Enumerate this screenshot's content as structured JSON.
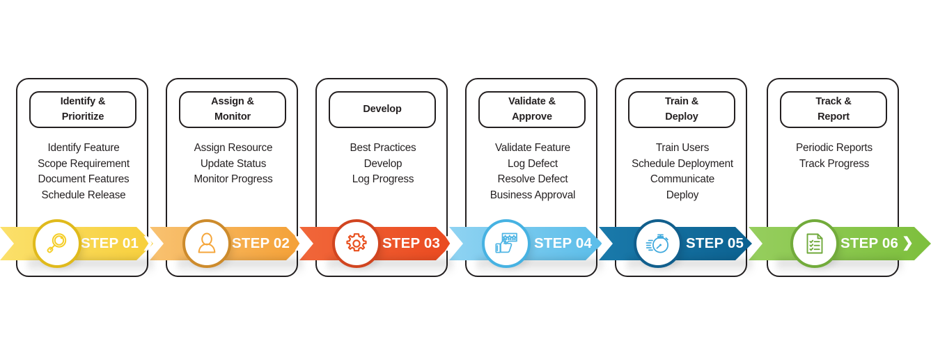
{
  "diagram": {
    "title": "Six Step Process Infographic",
    "type": "horizontal-step-process",
    "step_count": 6
  },
  "steps": [
    {
      "id": "step-01",
      "label": "STEP 01",
      "chevron": "❯",
      "title_line1": "Identify &",
      "title_line2": "Prioritize",
      "title": "Identify & Prioritize",
      "bullets": [
        "Identify Feature",
        "Scope Requirement",
        "Document Features",
        "Schedule Release"
      ],
      "icon": "magnifier-icon",
      "color": "#f9d94a",
      "color_dark": "#d9b61f",
      "color_light": "#fce37f",
      "icon_color": "#f3c516"
    },
    {
      "id": "step-02",
      "label": "STEP 02",
      "chevron": "❯",
      "title_line1": "Assign &",
      "title_line2": "Monitor",
      "title": "Assign & Monitor",
      "bullets": [
        "Assign Resource",
        "Update Status",
        "Monitor Progress"
      ],
      "icon": "user-icon",
      "color": "#f5a63b",
      "color_dark": "#c9802a",
      "color_light": "#f7c06b",
      "icon_color": "#f5a63b"
    },
    {
      "id": "step-03",
      "label": "STEP 03",
      "chevron": "❯",
      "title_line1": "Develop",
      "title_line2": "",
      "title": "Develop",
      "bullets": [
        "Best Practices",
        "Develop",
        "Log Progress"
      ],
      "icon": "gear-icon",
      "color": "#ef4a23",
      "color_dark": "#c23a18",
      "color_light": "#f3714d",
      "icon_color": "#e8501f"
    },
    {
      "id": "step-04",
      "label": "STEP 04",
      "chevron": "❯",
      "title_line1": "Validate &",
      "title_line2": "Approve",
      "title": "Validate & Approve",
      "bullets": [
        "Validate Feature",
        "Log Defect",
        "Resolve Defect",
        "Business Approval"
      ],
      "icon": "thumbs-up-rating-icon",
      "color": "#6dc6ee",
      "color_dark": "#3ba9d8",
      "color_light": "#9ddaf4",
      "icon_color": "#4fb5e4"
    },
    {
      "id": "step-05",
      "label": "STEP 05",
      "chevron": "❯",
      "title_line1": "Train &",
      "title_line2": "Deploy",
      "title": "Train & Deploy",
      "bullets": [
        "Train Users",
        "Schedule Deployment",
        "Communicate",
        "Deploy"
      ],
      "icon": "stopwatch-icon",
      "color": "#10699a",
      "color_dark": "#0c5078",
      "color_light": "#1c87bf",
      "icon_color": "#3fa9dd"
    },
    {
      "id": "step-06",
      "label": "STEP 06",
      "chevron": "❯",
      "title_line1": "Track &",
      "title_line2": "Report",
      "title": "Track & Report",
      "bullets": [
        "Periodic Reports",
        "Track Progress"
      ],
      "icon": "checklist-document-icon",
      "color": "#84c341",
      "color_dark": "#639a2b",
      "color_light": "#a5d472",
      "icon_color": "#6fa83a"
    }
  ],
  "style": {
    "background": "#ffffff",
    "card_border": "#231f20",
    "text_color": "#231f20",
    "label_text_color": "#ffffff"
  }
}
